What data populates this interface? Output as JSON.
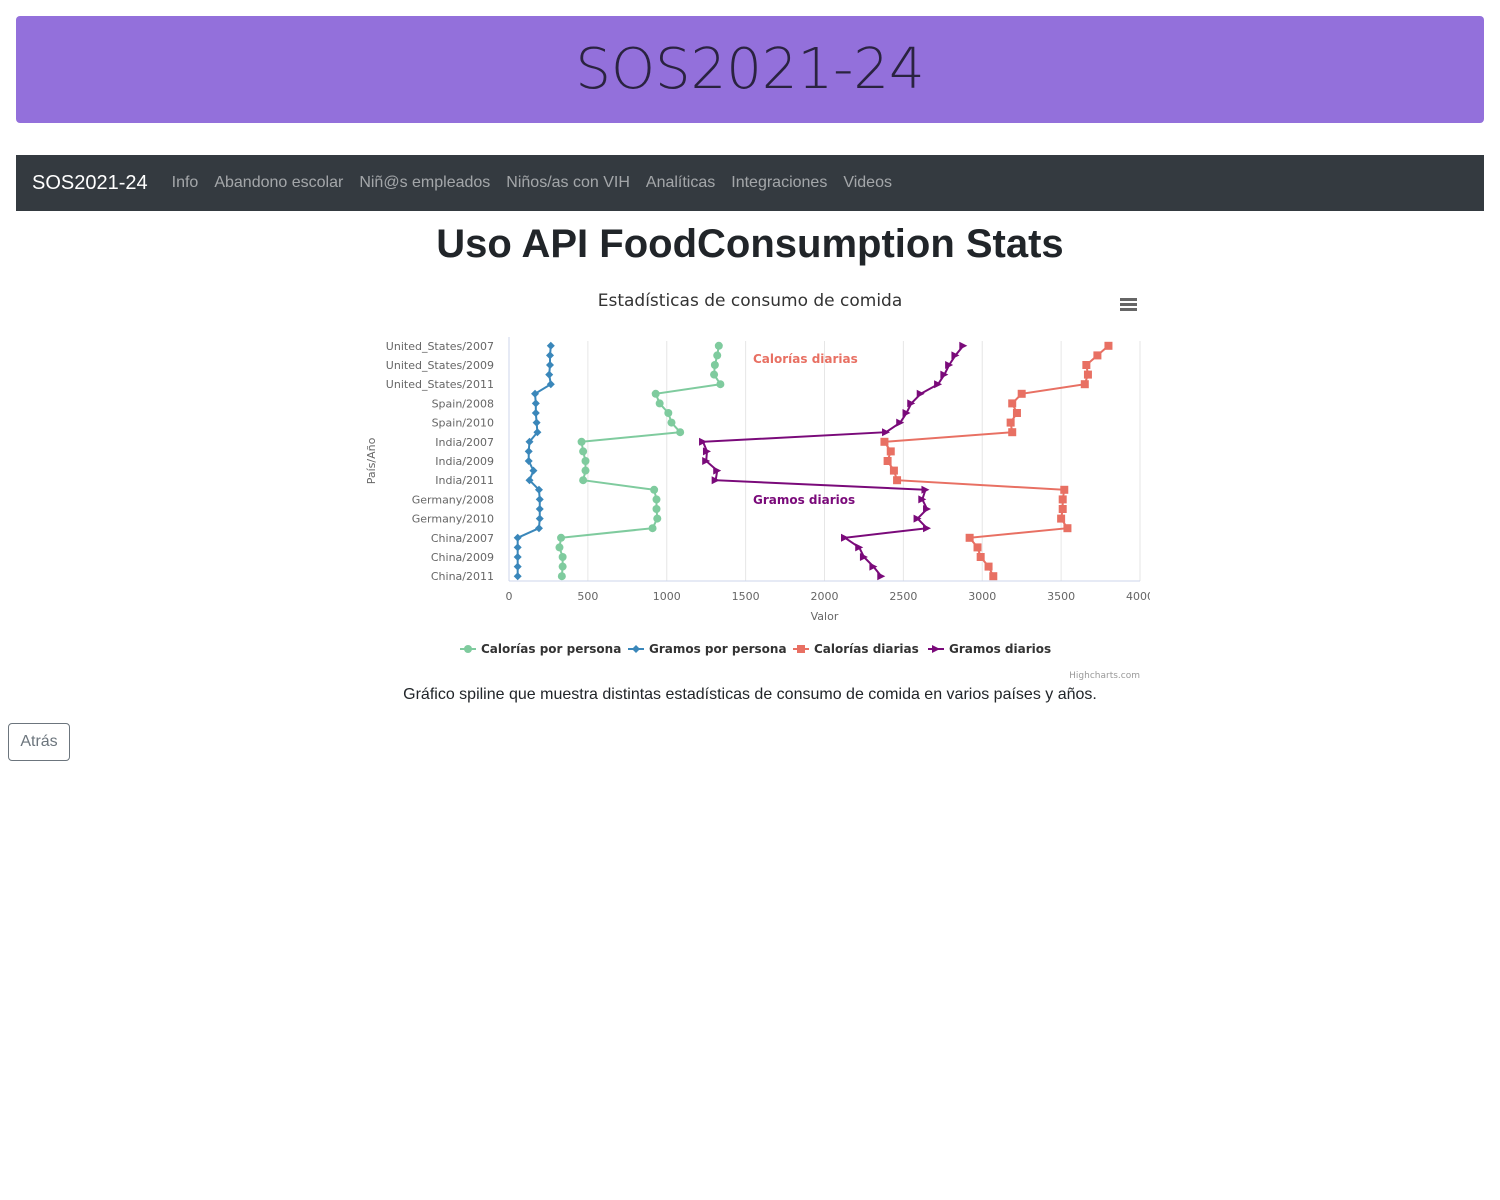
{
  "header": {
    "title": "SOS2021-24"
  },
  "navbar": {
    "brand": "SOS2021-24",
    "links": [
      "Info",
      "Abandono escolar",
      "Niñ@s empleados",
      "Niños/as con VIH",
      "Analíticas",
      "Integraciones",
      "Videos"
    ]
  },
  "page": {
    "title": "Uso API FoodConsumption Stats",
    "caption": "Gráfico spiline que muestra distintas estadísticas de consumo de comida en varios países y años.",
    "back_label": "Atrás"
  },
  "chart_data": {
    "type": "line",
    "inverted": true,
    "title": "Estadísticas de consumo de comida",
    "xlabel": "País/Año",
    "ylabel": "Valor",
    "credits": "Highcharts.com",
    "ylim": [
      0,
      4000
    ],
    "yticks": [
      0,
      500,
      1000,
      1500,
      2000,
      2500,
      3000,
      3500,
      4000
    ],
    "grid": true,
    "legend_position": "bottom-center",
    "categories": [
      "United_States/2007",
      "United_States/2008",
      "United_States/2009",
      "United_States/2010",
      "United_States/2011",
      "Spain/2007",
      "Spain/2008",
      "Spain/2009",
      "Spain/2010",
      "Spain/2011",
      "India/2007",
      "India/2008",
      "India/2009",
      "India/2010",
      "India/2011",
      "Germany/2007",
      "Germany/2008",
      "Germany/2009",
      "Germany/2010",
      "Germany/2011",
      "China/2007",
      "China/2008",
      "China/2009",
      "China/2010",
      "China/2011"
    ],
    "category_labels": [
      "United_States/2007",
      "",
      "United_States/2009",
      "",
      "United_States/2011",
      "",
      "Spain/2008",
      "",
      "Spain/2010",
      "",
      "India/2007",
      "",
      "India/2009",
      "",
      "India/2011",
      "",
      "Germany/2008",
      "",
      "Germany/2010",
      "",
      "China/2007",
      "",
      "China/2009",
      "",
      "China/2011"
    ],
    "series": [
      {
        "name": "Calorías por persona",
        "color": "#7fcb9e",
        "marker": "circle",
        "values": [
          1330,
          1320,
          1305,
          1300,
          1340,
          930,
          955,
          1010,
          1030,
          1085,
          460,
          470,
          485,
          485,
          470,
          920,
          935,
          935,
          940,
          910,
          330,
          320,
          340,
          340,
          335
        ]
      },
      {
        "name": "Gramos por persona",
        "color": "#3a87ba",
        "marker": "diamond",
        "values": [
          265,
          260,
          260,
          255,
          265,
          165,
          170,
          170,
          175,
          180,
          130,
          125,
          125,
          155,
          130,
          190,
          195,
          195,
          195,
          190,
          55,
          55,
          55,
          55,
          55
        ]
      },
      {
        "name": "Calorías diarias",
        "color": "#e87063",
        "marker": "square",
        "values": [
          3800,
          3730,
          3660,
          3670,
          3650,
          3250,
          3190,
          3220,
          3180,
          3190,
          2380,
          2420,
          2400,
          2440,
          2460,
          3520,
          3510,
          3510,
          3500,
          3540,
          2920,
          2970,
          2990,
          3040,
          3070
        ]
      },
      {
        "name": "Gramos diarios",
        "color": "#7a0a7a",
        "marker": "triangle",
        "values": [
          2880,
          2830,
          2790,
          2760,
          2720,
          2610,
          2550,
          2520,
          2480,
          2390,
          1230,
          1255,
          1250,
          1320,
          1310,
          2640,
          2620,
          2650,
          2590,
          2650,
          2130,
          2220,
          2250,
          2310,
          2360
        ]
      }
    ],
    "annotations": [
      {
        "text": "Calorías diarias",
        "color": "#e87063"
      },
      {
        "text": "Gramos diarios",
        "color": "#7a0a7a"
      }
    ]
  }
}
